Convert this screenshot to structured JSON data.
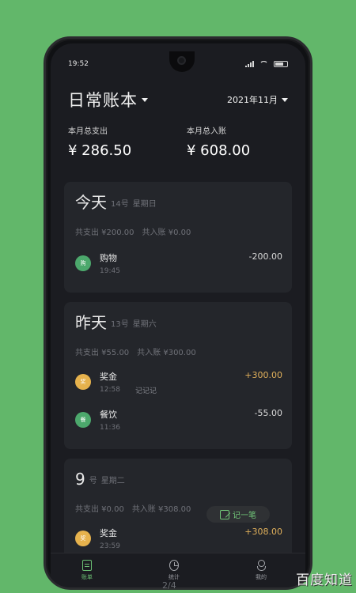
{
  "status_bar": {
    "time": "19:52",
    "battery": "55"
  },
  "header": {
    "title": "日常账本",
    "month": "2021年11月"
  },
  "summary": {
    "expense_label": "本月总支出",
    "expense_value": "¥ 286.50",
    "income_label": "本月总入账",
    "income_value": "¥ 608.00"
  },
  "days": [
    {
      "title": "今天",
      "date": "14号",
      "weekday": "星期日",
      "spent": "共支出 ¥200.00",
      "income": "共入账 ¥0.00",
      "entries": [
        {
          "icon_text": "购",
          "icon_color": "#4ca86c",
          "name": "购物",
          "time": "19:45",
          "note": "",
          "amount": "-200.00",
          "amount_color": "#d8d8d8"
        }
      ]
    },
    {
      "title": "昨天",
      "date": "13号",
      "weekday": "星期六",
      "spent": "共支出 ¥55.00",
      "income": "共入账 ¥300.00",
      "entries": [
        {
          "icon_text": "奖",
          "icon_color": "#e6b24d",
          "name": "奖金",
          "time": "12:58",
          "note": "记记记",
          "amount": "+300.00",
          "amount_color": "#e0b05b"
        },
        {
          "icon_text": "餐",
          "icon_color": "#4ca86c",
          "name": "餐饮",
          "time": "11:36",
          "note": "",
          "amount": "-55.00",
          "amount_color": "#d8d8d8"
        }
      ]
    },
    {
      "title": "9",
      "date": "号",
      "weekday": "星期二",
      "spent": "共支出 ¥0.00",
      "income": "共入账 ¥308.00",
      "entries": [
        {
          "icon_text": "奖",
          "icon_color": "#e6b24d",
          "name": "奖金",
          "time": "23:59",
          "note": "",
          "amount": "+308.00",
          "amount_color": "#e0b05b"
        }
      ]
    }
  ],
  "quick_add": {
    "label": "记一笔",
    "icon": "edit-icon"
  },
  "tabs": [
    {
      "label": "账单",
      "icon": "notes-icon",
      "active": true
    },
    {
      "label": "统计",
      "icon": "stats-icon",
      "active": false
    },
    {
      "label": "我的",
      "icon": "person-icon",
      "active": false
    }
  ],
  "pager": "2/4",
  "watermark": "百度知道",
  "colors": {
    "background": "#62b76a",
    "screen": "#1b1c21",
    "card": "#24262b",
    "accent_green": "#6bbf73",
    "accent_gold": "#e0b05b"
  }
}
